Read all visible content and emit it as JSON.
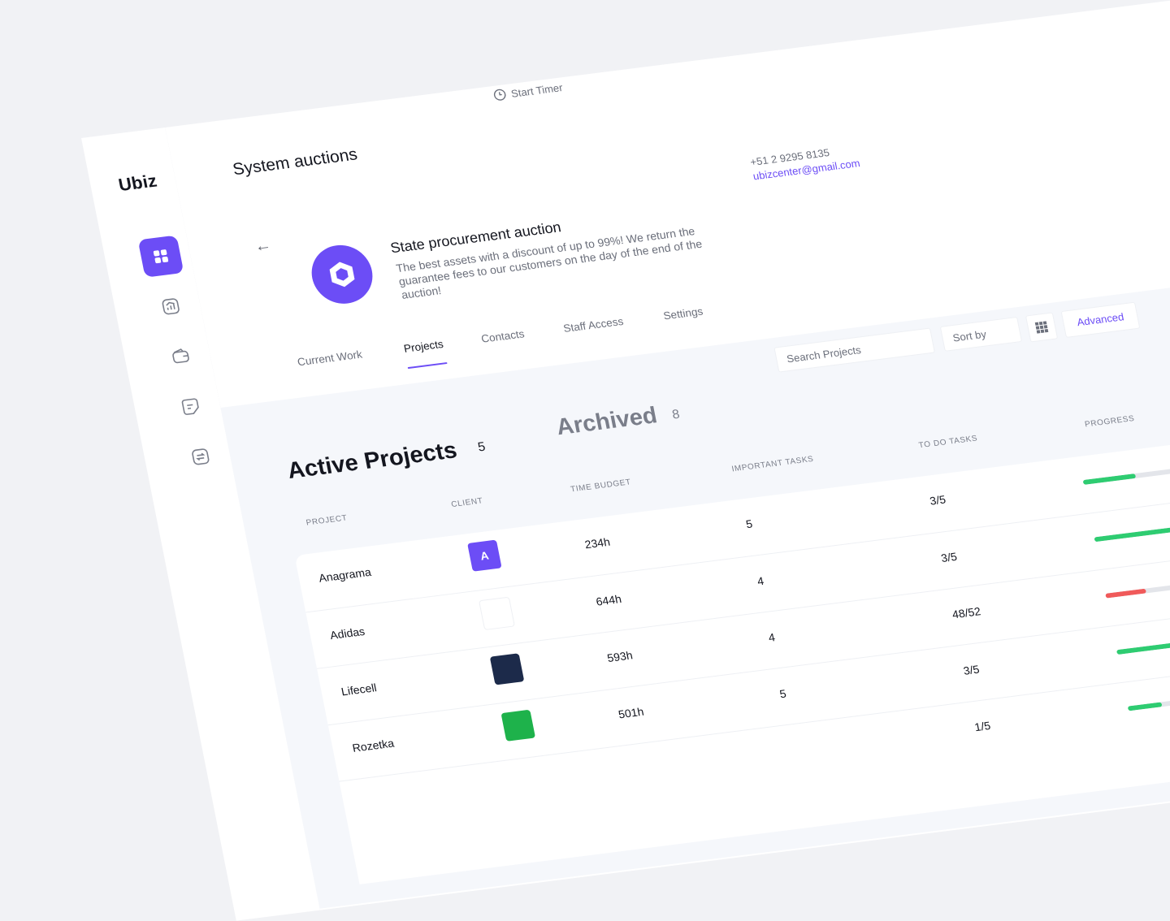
{
  "sidebar": {
    "logo": "Ubiz",
    "items": [
      {
        "icon": "grid-icon",
        "active": true
      },
      {
        "icon": "chart-icon",
        "active": false
      },
      {
        "icon": "wallet-icon",
        "active": false
      },
      {
        "icon": "note-icon",
        "active": false
      },
      {
        "icon": "transfer-icon",
        "active": false
      }
    ]
  },
  "header": {
    "title": "System auctions",
    "timer_label": "Start Timer"
  },
  "project": {
    "name": "State procurement auction",
    "description": "The best assets with a discount of up to 99%! We return the guarantee fees to our customers on the day of the end of the auction!",
    "phone": "+51 2 9295 8135",
    "email": "ubizcenter@gmail.com"
  },
  "tabs": [
    {
      "label": "Current Work",
      "active": false
    },
    {
      "label": "Projects",
      "active": true
    },
    {
      "label": "Contacts",
      "active": false
    },
    {
      "label": "Staff Access",
      "active": false
    },
    {
      "label": "Settings",
      "active": false
    }
  ],
  "controls": {
    "search_placeholder": "Search Projects",
    "sort_label": "Sort by",
    "advanced_label": "Advanced"
  },
  "sections": {
    "active_title": "Active Projects",
    "active_count": "5",
    "archived_title": "Archived",
    "archived_count": "8"
  },
  "table": {
    "headers": [
      "Project",
      "Client",
      "Time Budget",
      "Important Tasks",
      "To Do Tasks",
      "Progress"
    ],
    "rows": [
      {
        "project": "Anagrama",
        "client": "A",
        "client_color": "#6c4df6",
        "time": "234h",
        "important": "5",
        "todo": "3/5",
        "progress": 0.55,
        "bar_color": "#2ecc71"
      },
      {
        "project": "Adidas",
        "client": "",
        "client_color": "#ffffff",
        "time": "644h",
        "important": "4",
        "todo": "3/5",
        "progress": 0.88,
        "bar_color": "#2ecc71"
      },
      {
        "project": "Lifecell",
        "client": "",
        "client_color": "#1c2a4a",
        "time": "593h",
        "important": "4",
        "todo": "48/52",
        "progress": 0.42,
        "bar_color": "#f05a5a"
      },
      {
        "project": "Rozetka",
        "client": "",
        "client_color": "#1eb24b",
        "time": "501h",
        "important": "5",
        "todo": "3/5",
        "progress": 0.62,
        "bar_color": "#2ecc71"
      },
      {
        "project": "",
        "client": "",
        "client_color": "#ffffff",
        "time": "",
        "important": "",
        "todo": "1/5",
        "progress": 0.36,
        "bar_color": "#2ecc71"
      }
    ]
  }
}
